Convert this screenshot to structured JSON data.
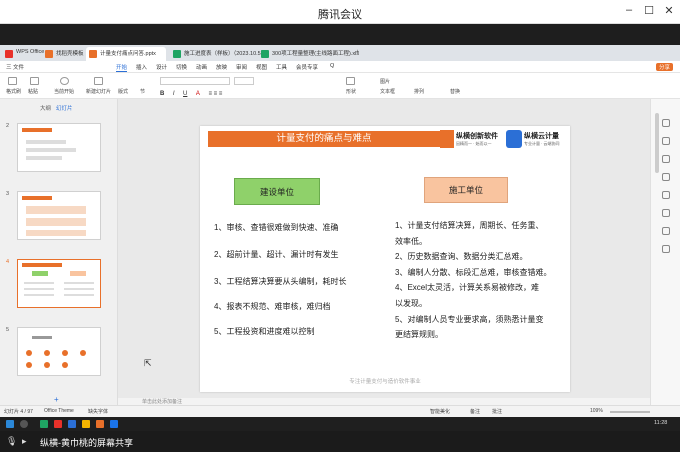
{
  "meeting": {
    "title": "腾讯会议"
  },
  "tabs": [
    {
      "label": "WPS Office",
      "color": "#e8312a"
    },
    {
      "label": "找稻壳模板",
      "color": "#e8702a"
    },
    {
      "label": "计量支付痛点问答.pptx",
      "color": "#e8702a",
      "active": true
    },
    {
      "label": "施工进度表（样板）（2023.10.5）",
      "color": "#1fa463"
    },
    {
      "label": "300项工程量整理(主线路面工程).xls",
      "color": "#1fa463"
    }
  ],
  "menu": {
    "file": "三 文件",
    "items": [
      "开始",
      "插入",
      "设计",
      "切换",
      "动画",
      "放映",
      "审阅",
      "视图",
      "工具",
      "会员专享"
    ],
    "search": "Q",
    "share": "分享"
  },
  "ribbon": {
    "labels": [
      "格式刷",
      "粘贴",
      "当前开始",
      "新建幻灯片",
      "版式",
      "节",
      "形状",
      "图片",
      "文本框",
      "排列",
      "替换"
    ]
  },
  "panel": {
    "tab_outline": "大纲",
    "tab_slides": "幻灯片",
    "slide_numbers": [
      "2",
      "3",
      "4",
      "5"
    ]
  },
  "slide": {
    "title": "计量支付的痛点与难点",
    "logo1_text": "纵横创新软件",
    "logo1_sub": "因精而一 · 始而以一",
    "logo2_text": "纵横云计量",
    "logo2_sub": "专业计量 · 云端协同",
    "col_left": "建设单位",
    "col_right": "施工单位",
    "left_items": [
      "1、审核、查错很难做到快速、准确",
      "2、超前计量、超计、漏计时有发生",
      "3、工程结算决算要从头编制，耗时长",
      "4、报表不规范、难审核，难归档",
      "5、工程投资和进度难以控制"
    ],
    "right_items": [
      "1、计量支付结算决算，周期长、任务重、",
      "效率低。",
      "2、历史数据查询、数据分类汇总难。",
      "3、编制人分散、标段汇总难，审核查错难。",
      "4、Excel太灵活，计算关系易被修改，难",
      "以发现。",
      "5、对编制人员专业要求高，须熟悉计量变",
      "更结算规则。"
    ],
    "footer": "专注计量支付与造价软件事业"
  },
  "notes_placeholder": "单击此处添加备注",
  "status": {
    "slide_info": "幻灯片 4 / 97",
    "theme": "Office Theme",
    "missing_font": "缺失字体",
    "smart": "智能美化",
    "notes": "备注",
    "comment": "批注",
    "zoom": "109%"
  },
  "taskbar": {
    "time": "11:28"
  },
  "share_bar": {
    "text": "纵横-黄巾桃的屏幕共享"
  }
}
